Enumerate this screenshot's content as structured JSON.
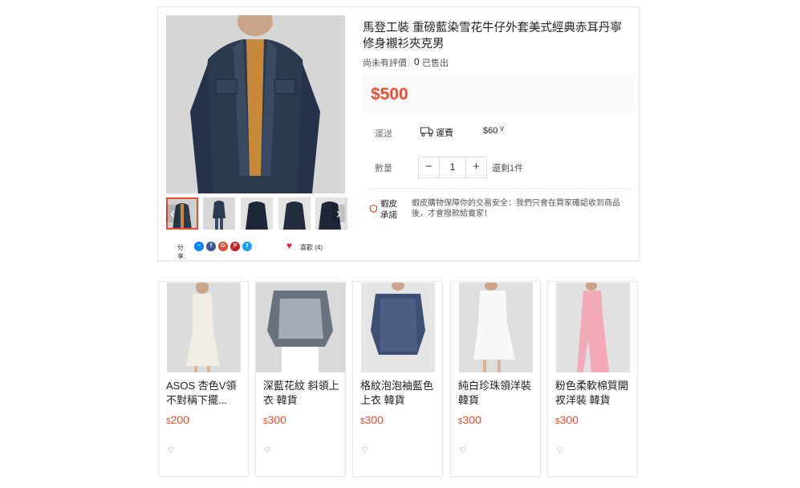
{
  "product": {
    "title": "馬登工裝 重磅藍染雪花牛仔外套美式經典赤耳丹寧修身襯衫夾克男",
    "rating_text": "尚未有評價",
    "sold_count": "0",
    "sold_label": "已售出",
    "price": "$500",
    "shipping_label": "運送",
    "shipping_method": "運費",
    "shipping_fee": "$60",
    "quantity_label": "數量",
    "quantity_value": "1",
    "stock_text": "還剩1件",
    "guarantee_title": "蝦皮承諾",
    "guarantee_text": "蝦皮購物保障你的交易安全：我們只會在買家確認收到商品後，才會撥款給賣家！",
    "share_label": "分享:",
    "like_text": "喜歡 (4)",
    "share_icons": [
      "messenger-icon",
      "facebook-icon",
      "google-plus-icon",
      "pinterest-icon",
      "twitter-icon"
    ]
  },
  "related": [
    {
      "name": "ASOS 杏色V領不對稱下擺...",
      "currency": "$",
      "price": "200"
    },
    {
      "name": "深藍花紋 斜領上衣 韓貨",
      "currency": "$",
      "price": "300"
    },
    {
      "name": "格紋泡泡袖藍色上衣 韓貨",
      "currency": "$",
      "price": "300"
    },
    {
      "name": "純白珍珠領洋裝 韓貨",
      "currency": "$",
      "price": "300"
    },
    {
      "name": "粉色柔軟棉質開衩洋裝 韓貨",
      "currency": "$",
      "price": "300"
    }
  ],
  "colors": {
    "accent": "#ee4d2d",
    "heart": "#e0203c"
  }
}
